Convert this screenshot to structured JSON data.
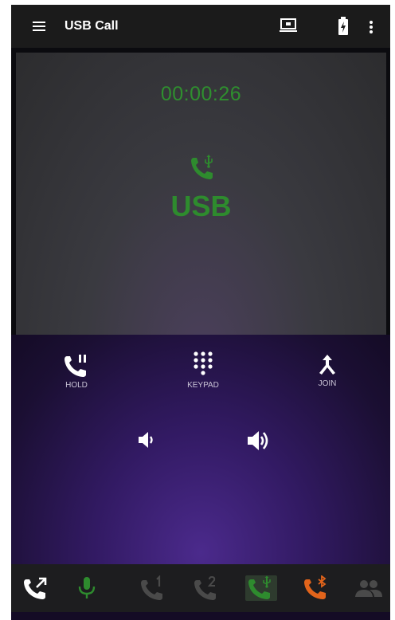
{
  "appbar": {
    "title": "USB Call"
  },
  "call": {
    "timer": "00:00:26",
    "source_label": "USB"
  },
  "controls": {
    "hold_label": "HOLD",
    "keypad_label": "KEYPAD",
    "join_label": "JOIN"
  },
  "colors": {
    "accent_green": "#2e8b2e",
    "bluetooth_orange": "#e2641b",
    "inactive_icon": "#4a4a4a",
    "appbar_bg": "#1b1b1b"
  },
  "icons": [
    "menu-icon",
    "cast-icon",
    "battery-icon",
    "more-vert-icon",
    "usb-call-icon",
    "hold-call-icon",
    "keypad-icon",
    "join-call-icon",
    "volume-down-icon",
    "volume-up-icon",
    "call-transfer-icon",
    "microphone-icon",
    "line-1-icon",
    "line-2-icon",
    "usb-line-icon",
    "bluetooth-call-icon",
    "conference-icon"
  ]
}
